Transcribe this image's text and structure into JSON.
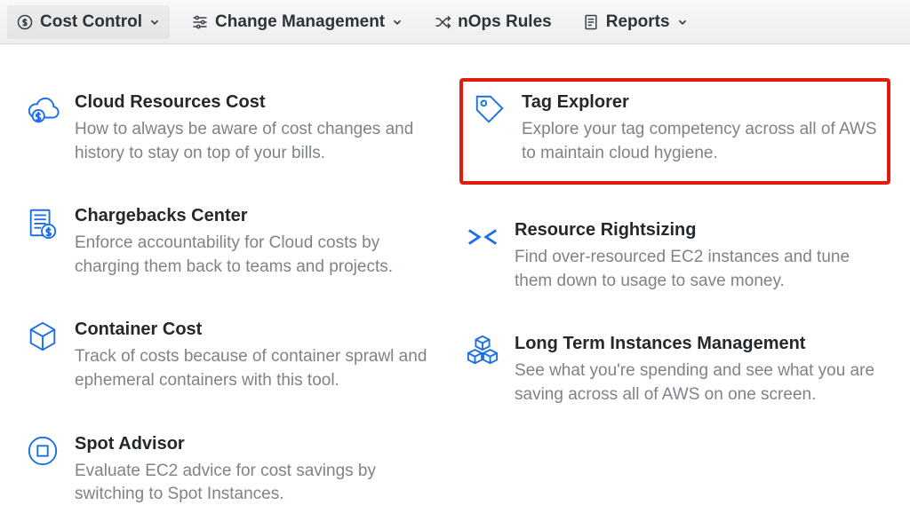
{
  "nav": {
    "cost_control": "Cost Control",
    "change_management": "Change Management",
    "nops_rules": "nOps Rules",
    "reports": "Reports"
  },
  "cards": {
    "cloud_resources_cost": {
      "title": "Cloud Resources Cost",
      "desc": "How to always be aware of cost changes and history to stay on top of your bills."
    },
    "chargebacks_center": {
      "title": "Chargebacks Center",
      "desc": "Enforce accountability for Cloud costs by charging them back to teams and projects."
    },
    "container_cost": {
      "title": "Container Cost",
      "desc": "Track of costs because of container sprawl and ephemeral containers with this tool."
    },
    "spot_advisor": {
      "title": "Spot Advisor",
      "desc": "Evaluate EC2 advice for cost savings by switching to Spot Instances."
    },
    "tag_explorer": {
      "title": "Tag Explorer",
      "desc": "Explore your tag competency across all of AWS to maintain cloud hygiene."
    },
    "resource_rightsizing": {
      "title": "Resource Rightsizing",
      "desc": "Find over-resourced EC2 instances and tune them down to usage to save money."
    },
    "long_term_instances": {
      "title": "Long Term Instances Management",
      "desc": "See what you're spending and see what you are saving across all of AWS on one screen."
    }
  }
}
